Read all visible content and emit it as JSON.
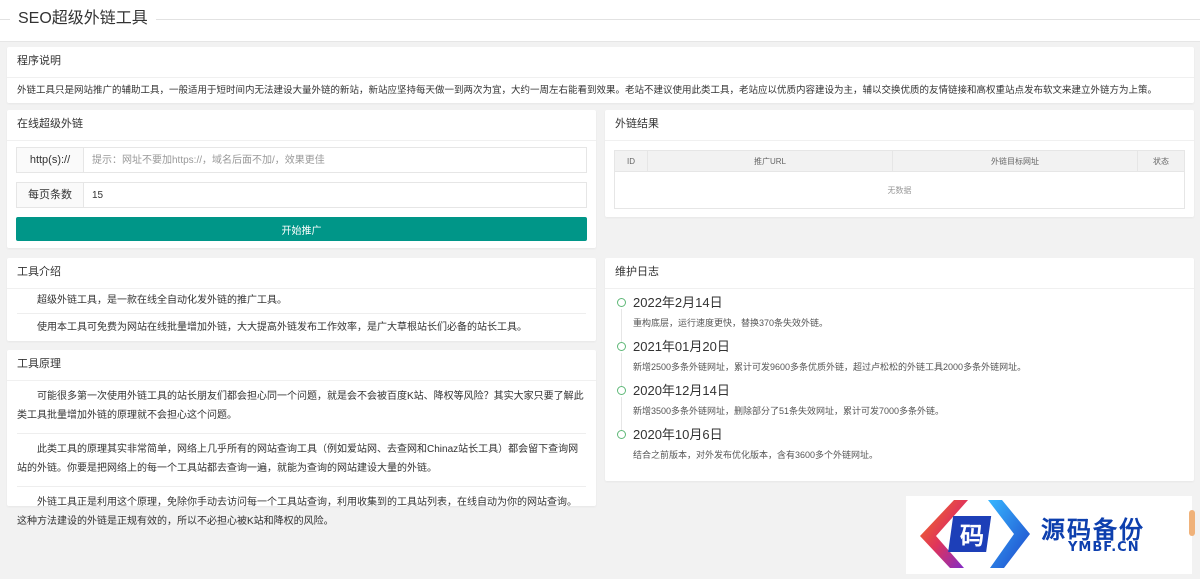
{
  "page": {
    "title": "SEO超级外链工具"
  },
  "intro": {
    "header": "程序说明",
    "text": "外链工具只是网站推广的辅助工具，一般适用于短时间内无法建设大量外链的新站，新站应坚持每天做一到两次为宜，大约一周左右能看到效果。老站不建议使用此类工具，老站应以优质内容建设为主，辅以交换优质的友情链接和高权重站点发布软文来建立外链方为上策。"
  },
  "online": {
    "header": "在线超级外链",
    "url_label": "http(s)://",
    "url_placeholder": "提示：网址不要加https://，域名后面不加/，效果更佳",
    "per_page_label": "每页条数",
    "per_page_value": "15",
    "submit_label": "开始推广"
  },
  "results": {
    "header": "外链结果",
    "columns": [
      "ID",
      "推广URL",
      "外链目标网址",
      "状态"
    ],
    "empty": "无数据"
  },
  "tool_intro": {
    "header": "工具介绍",
    "paragraphs": [
      "超级外链工具，是一款在线全自动化发外链的推广工具。",
      "使用本工具可免费为网站在线批量增加外链，大大提高外链发布工作效率，是广大草根站长们必备的站长工具。"
    ]
  },
  "principle": {
    "header": "工具原理",
    "paragraphs": [
      "可能很多第一次使用外链工具的站长朋友们都会担心同一个问题，就是会不会被百度K站、降权等风险？其实大家只要了解此类工具批量增加外链的原理就不会担心这个问题。",
      "此类工具的原理其实非常简单，网络上几乎所有的网站查询工具（例如爱站网、去查网和Chinaz站长工具）都会留下查询网站的外链。你要是把网络上的每一个工具站都去查询一遍，就能为查询的网站建设大量的外链。",
      "外链工具正是利用这个原理，免除你手动去访问每一个工具站查询，利用收集到的工具站列表，在线自动为你的网站查询。这种方法建设的外链是正规有效的，所以不必担心被K站和降权的风险。"
    ]
  },
  "changelog": {
    "header": "维护日志",
    "items": [
      {
        "date": "2022年2月14日",
        "text": "重构底层，运行速度更快，替换370条失效外链。"
      },
      {
        "date": "2021年01月20日",
        "text": "新增2500多条外链网址，累计可发9600多条优质外链，超过卢松松的外链工具2000多条外链网址。"
      },
      {
        "date": "2020年12月14日",
        "text": "新增3500多条外链网址，删除部分了51条失效网址，累计可发7000多条外链。"
      },
      {
        "date": "2020年10月6日",
        "text": "结合之前版本，对外发布优化版本，含有3600多个外链网址。"
      }
    ]
  },
  "watermark": {
    "logo_char": "码",
    "text": "源码备份",
    "sub": "YMBF.CN"
  },
  "colors": {
    "primary": "#009688",
    "timeline": "#5FB878",
    "watermark": "#0d3fae"
  }
}
